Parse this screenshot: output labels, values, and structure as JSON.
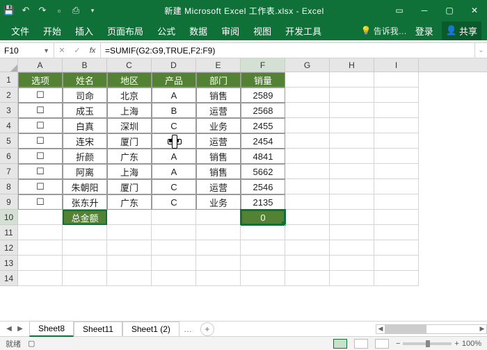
{
  "app": {
    "title": "新建 Microsoft Excel 工作表.xlsx - Excel"
  },
  "qat": {
    "save": "save-icon",
    "undo": "undo-icon",
    "redo": "redo-icon",
    "new": "new-icon",
    "print": "print-icon"
  },
  "window": {
    "ribbon_opts": "ribbon-options-icon",
    "minimize": "minimize-icon",
    "restore": "restore-icon",
    "close": "close-icon"
  },
  "ribbon": {
    "tabs": [
      "文件",
      "开始",
      "插入",
      "页面布局",
      "公式",
      "数据",
      "审阅",
      "视图",
      "开发工具"
    ],
    "tell": "告诉我…",
    "signin": "登录",
    "share": "共享"
  },
  "formula": {
    "namebox": "F10",
    "fx": "fx",
    "value": "=SUMIF(G2:G9,TRUE,F2:F9)"
  },
  "columns": [
    "A",
    "B",
    "C",
    "D",
    "E",
    "F",
    "G",
    "H",
    "I"
  ],
  "headers": {
    "a": "选项",
    "b": "姓名",
    "c": "地区",
    "d": "产品",
    "e": "部门",
    "f": "销量"
  },
  "rows": [
    {
      "a": "☐",
      "b": "司命",
      "c": "北京",
      "d": "A",
      "e": "销售",
      "f": "2589"
    },
    {
      "a": "☐",
      "b": "成玉",
      "c": "上海",
      "d": "B",
      "e": "运营",
      "f": "2568"
    },
    {
      "a": "☐",
      "b": "白真",
      "c": "深圳",
      "d": "C",
      "e": "业务",
      "f": "2455"
    },
    {
      "a": "☐",
      "b": "连宋",
      "c": "厦门",
      "d": "D",
      "e": "运营",
      "f": "2454"
    },
    {
      "a": "☐",
      "b": "折颜",
      "c": "广东",
      "d": "A",
      "e": "销售",
      "f": "4841"
    },
    {
      "a": "☐",
      "b": "阿离",
      "c": "上海",
      "d": "A",
      "e": "销售",
      "f": "5662"
    },
    {
      "a": "☐",
      "b": "朱朝阳",
      "c": "厦门",
      "d": "C",
      "e": "运营",
      "f": "2546"
    },
    {
      "a": "☐",
      "b": "张东升",
      "c": "广东",
      "d": "C",
      "e": "业务",
      "f": "2135"
    }
  ],
  "summary": {
    "label": "总金额",
    "value": "0"
  },
  "sheets": {
    "tabs": [
      "Sheet8",
      "Sheet11",
      "Sheet1 (2)"
    ],
    "more": "…",
    "active": 0
  },
  "status": {
    "ready": "就绪",
    "macro": "",
    "zoom": "100%",
    "plus": "+",
    "minus": "−"
  }
}
